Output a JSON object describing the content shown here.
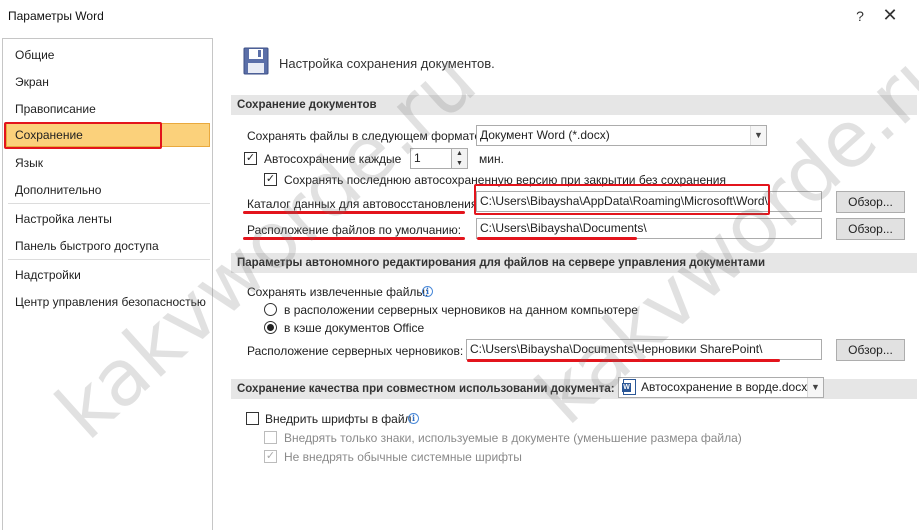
{
  "window": {
    "title": "Параметры Word",
    "help_label": "?",
    "close_label": "✕"
  },
  "sidebar": {
    "items": [
      {
        "label": "Общие"
      },
      {
        "label": "Экран"
      },
      {
        "label": "Правописание"
      },
      {
        "label": "Сохранение",
        "selected": true
      },
      {
        "label": "Язык"
      },
      {
        "label": "Дополнительно"
      },
      {
        "label": "Настройка ленты"
      },
      {
        "label": "Панель быстрого доступа"
      },
      {
        "label": "Надстройки"
      },
      {
        "label": "Центр управления безопасностью"
      }
    ]
  },
  "header": {
    "icon": "save-disk-icon",
    "text": "Настройка сохранения документов."
  },
  "save_docs": {
    "title": "Сохранение документов",
    "format_label": "Сохранять файлы в следующем формате:",
    "format_value": "Документ Word (*.docx)",
    "autosave_label": "Автосохранение каждые",
    "autosave_checked": true,
    "autosave_value": "1",
    "autosave_unit": "мин.",
    "keep_last_label": "Сохранять последнюю автосохраненную версию при закрытии без сохранения",
    "keep_last_checked": true,
    "autorecover_label": "Каталог данных для автовосстановления:",
    "autorecover_path": "C:\\Users\\Bibaysha\\AppData\\Roaming\\Microsoft\\Word\\",
    "default_location_label": "Расположение файлов по умолчанию:",
    "default_location_path": "C:\\Users\\Bibaysha\\Documents\\",
    "browse_label": "Обзор..."
  },
  "offline": {
    "title": "Параметры автономного редактирования для файлов на сервере управления документами",
    "save_checked_out_label": "Сохранять извлеченные файлы:",
    "option_server_drafts": "в расположении серверных черновиков на данном компьютере",
    "option_office_cache": "в кэше документов Office",
    "selected_option": "option_office_cache",
    "server_drafts_label": "Расположение серверных черновиков:",
    "server_drafts_path": "C:\\Users\\Bibaysha\\Documents\\Черновики SharePoint\\",
    "browse_label": "Обзор..."
  },
  "fidelity": {
    "title": "Сохранение качества при совместном использовании документа:",
    "document": "Автосохранение в ворде.docx",
    "embed_fonts_label": "Внедрить шрифты в файл",
    "embed_fonts_checked": false,
    "embed_used_chars_label": "Внедрять только знаки, используемые в документе (уменьшение размера файла)",
    "embed_used_chars_checked": false,
    "no_common_fonts_label": "Не внедрять обычные системные шрифты",
    "no_common_fonts_checked": true
  },
  "watermark": {
    "text": "kakvworde.ru"
  },
  "colors": {
    "annotation_red": "#e3141c",
    "selected_bg": "#fbd17b",
    "section_bg": "#e6e6e6"
  }
}
